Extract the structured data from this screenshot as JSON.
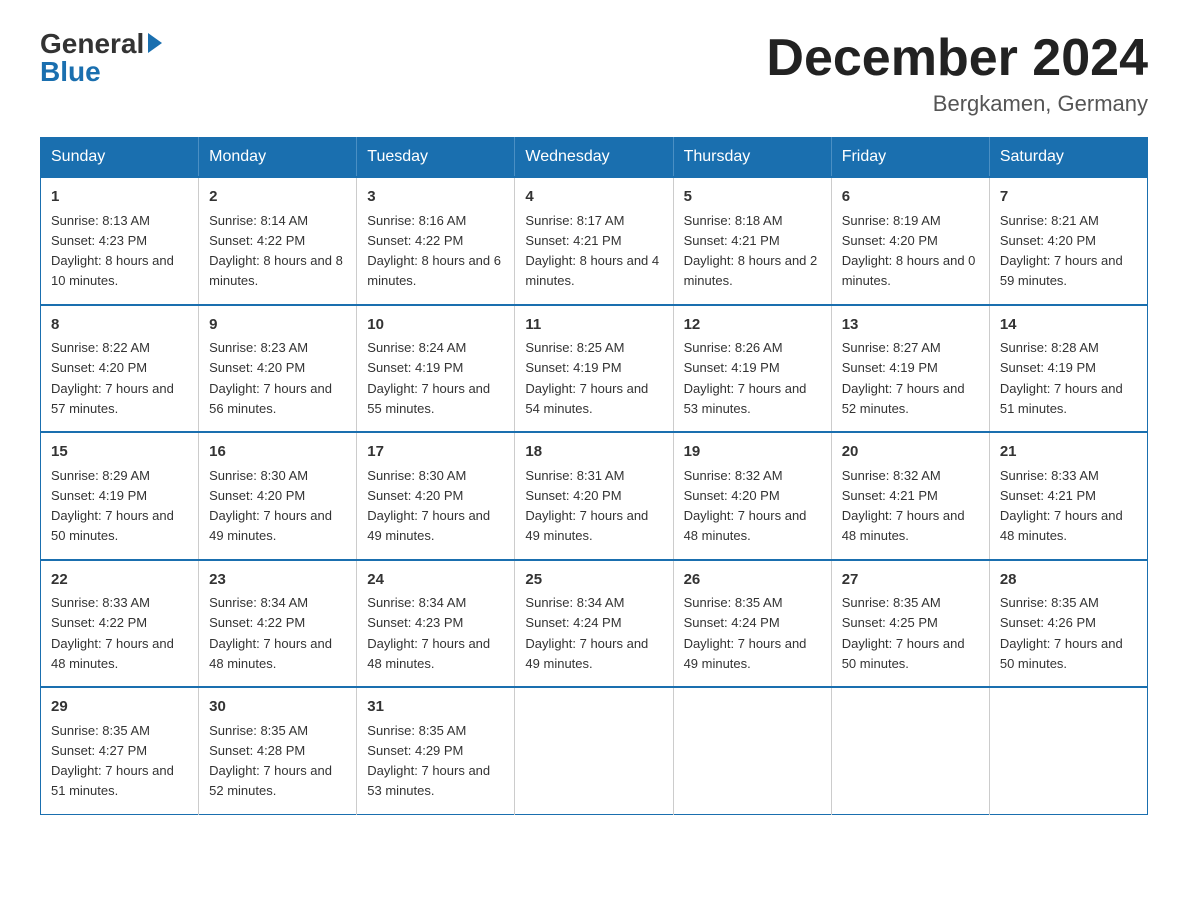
{
  "logo": {
    "general": "General",
    "blue": "Blue"
  },
  "title": "December 2024",
  "location": "Bergkamen, Germany",
  "headers": [
    "Sunday",
    "Monday",
    "Tuesday",
    "Wednesday",
    "Thursday",
    "Friday",
    "Saturday"
  ],
  "weeks": [
    [
      {
        "day": "1",
        "sunrise": "8:13 AM",
        "sunset": "4:23 PM",
        "daylight": "8 hours and 10 minutes."
      },
      {
        "day": "2",
        "sunrise": "8:14 AM",
        "sunset": "4:22 PM",
        "daylight": "8 hours and 8 minutes."
      },
      {
        "day": "3",
        "sunrise": "8:16 AM",
        "sunset": "4:22 PM",
        "daylight": "8 hours and 6 minutes."
      },
      {
        "day": "4",
        "sunrise": "8:17 AM",
        "sunset": "4:21 PM",
        "daylight": "8 hours and 4 minutes."
      },
      {
        "day": "5",
        "sunrise": "8:18 AM",
        "sunset": "4:21 PM",
        "daylight": "8 hours and 2 minutes."
      },
      {
        "day": "6",
        "sunrise": "8:19 AM",
        "sunset": "4:20 PM",
        "daylight": "8 hours and 0 minutes."
      },
      {
        "day": "7",
        "sunrise": "8:21 AM",
        "sunset": "4:20 PM",
        "daylight": "7 hours and 59 minutes."
      }
    ],
    [
      {
        "day": "8",
        "sunrise": "8:22 AM",
        "sunset": "4:20 PM",
        "daylight": "7 hours and 57 minutes."
      },
      {
        "day": "9",
        "sunrise": "8:23 AM",
        "sunset": "4:20 PM",
        "daylight": "7 hours and 56 minutes."
      },
      {
        "day": "10",
        "sunrise": "8:24 AM",
        "sunset": "4:19 PM",
        "daylight": "7 hours and 55 minutes."
      },
      {
        "day": "11",
        "sunrise": "8:25 AM",
        "sunset": "4:19 PM",
        "daylight": "7 hours and 54 minutes."
      },
      {
        "day": "12",
        "sunrise": "8:26 AM",
        "sunset": "4:19 PM",
        "daylight": "7 hours and 53 minutes."
      },
      {
        "day": "13",
        "sunrise": "8:27 AM",
        "sunset": "4:19 PM",
        "daylight": "7 hours and 52 minutes."
      },
      {
        "day": "14",
        "sunrise": "8:28 AM",
        "sunset": "4:19 PM",
        "daylight": "7 hours and 51 minutes."
      }
    ],
    [
      {
        "day": "15",
        "sunrise": "8:29 AM",
        "sunset": "4:19 PM",
        "daylight": "7 hours and 50 minutes."
      },
      {
        "day": "16",
        "sunrise": "8:30 AM",
        "sunset": "4:20 PM",
        "daylight": "7 hours and 49 minutes."
      },
      {
        "day": "17",
        "sunrise": "8:30 AM",
        "sunset": "4:20 PM",
        "daylight": "7 hours and 49 minutes."
      },
      {
        "day": "18",
        "sunrise": "8:31 AM",
        "sunset": "4:20 PM",
        "daylight": "7 hours and 49 minutes."
      },
      {
        "day": "19",
        "sunrise": "8:32 AM",
        "sunset": "4:20 PM",
        "daylight": "7 hours and 48 minutes."
      },
      {
        "day": "20",
        "sunrise": "8:32 AM",
        "sunset": "4:21 PM",
        "daylight": "7 hours and 48 minutes."
      },
      {
        "day": "21",
        "sunrise": "8:33 AM",
        "sunset": "4:21 PM",
        "daylight": "7 hours and 48 minutes."
      }
    ],
    [
      {
        "day": "22",
        "sunrise": "8:33 AM",
        "sunset": "4:22 PM",
        "daylight": "7 hours and 48 minutes."
      },
      {
        "day": "23",
        "sunrise": "8:34 AM",
        "sunset": "4:22 PM",
        "daylight": "7 hours and 48 minutes."
      },
      {
        "day": "24",
        "sunrise": "8:34 AM",
        "sunset": "4:23 PM",
        "daylight": "7 hours and 48 minutes."
      },
      {
        "day": "25",
        "sunrise": "8:34 AM",
        "sunset": "4:24 PM",
        "daylight": "7 hours and 49 minutes."
      },
      {
        "day": "26",
        "sunrise": "8:35 AM",
        "sunset": "4:24 PM",
        "daylight": "7 hours and 49 minutes."
      },
      {
        "day": "27",
        "sunrise": "8:35 AM",
        "sunset": "4:25 PM",
        "daylight": "7 hours and 50 minutes."
      },
      {
        "day": "28",
        "sunrise": "8:35 AM",
        "sunset": "4:26 PM",
        "daylight": "7 hours and 50 minutes."
      }
    ],
    [
      {
        "day": "29",
        "sunrise": "8:35 AM",
        "sunset": "4:27 PM",
        "daylight": "7 hours and 51 minutes."
      },
      {
        "day": "30",
        "sunrise": "8:35 AM",
        "sunset": "4:28 PM",
        "daylight": "7 hours and 52 minutes."
      },
      {
        "day": "31",
        "sunrise": "8:35 AM",
        "sunset": "4:29 PM",
        "daylight": "7 hours and 53 minutes."
      },
      null,
      null,
      null,
      null
    ]
  ]
}
